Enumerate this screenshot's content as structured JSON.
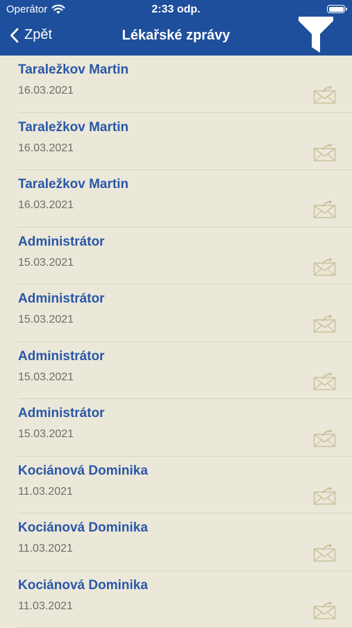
{
  "status": {
    "carrier": "Operátor",
    "time": "2:33 odp."
  },
  "nav": {
    "back_label": "Zpět",
    "title": "Lékařské zprávy"
  },
  "messages": [
    {
      "sender": "Taraležkov Martin",
      "date": "16.03.2021"
    },
    {
      "sender": "Taraležkov Martin",
      "date": "16.03.2021"
    },
    {
      "sender": "Taraležkov Martin",
      "date": "16.03.2021"
    },
    {
      "sender": "Administrátor",
      "date": "15.03.2021"
    },
    {
      "sender": "Administrátor",
      "date": "15.03.2021"
    },
    {
      "sender": "Administrátor",
      "date": "15.03.2021"
    },
    {
      "sender": "Administrátor",
      "date": "15.03.2021"
    },
    {
      "sender": "Kociánová Dominika",
      "date": "11.03.2021"
    },
    {
      "sender": "Kociánová Dominika",
      "date": "11.03.2021"
    },
    {
      "sender": "Kociánová Dominika",
      "date": "11.03.2021"
    }
  ],
  "colors": {
    "bar": "#1e4f9c",
    "background": "#ebe8da",
    "sender_text": "#2a57a6",
    "date_text": "#6f6d62",
    "mail_icon": "#c9c39b"
  },
  "icons": {
    "back": "chevron-left-icon",
    "filter": "filter-funnel-icon",
    "row": "envelope-forward-icon",
    "wifi": "wifi-icon",
    "battery": "battery-icon"
  }
}
